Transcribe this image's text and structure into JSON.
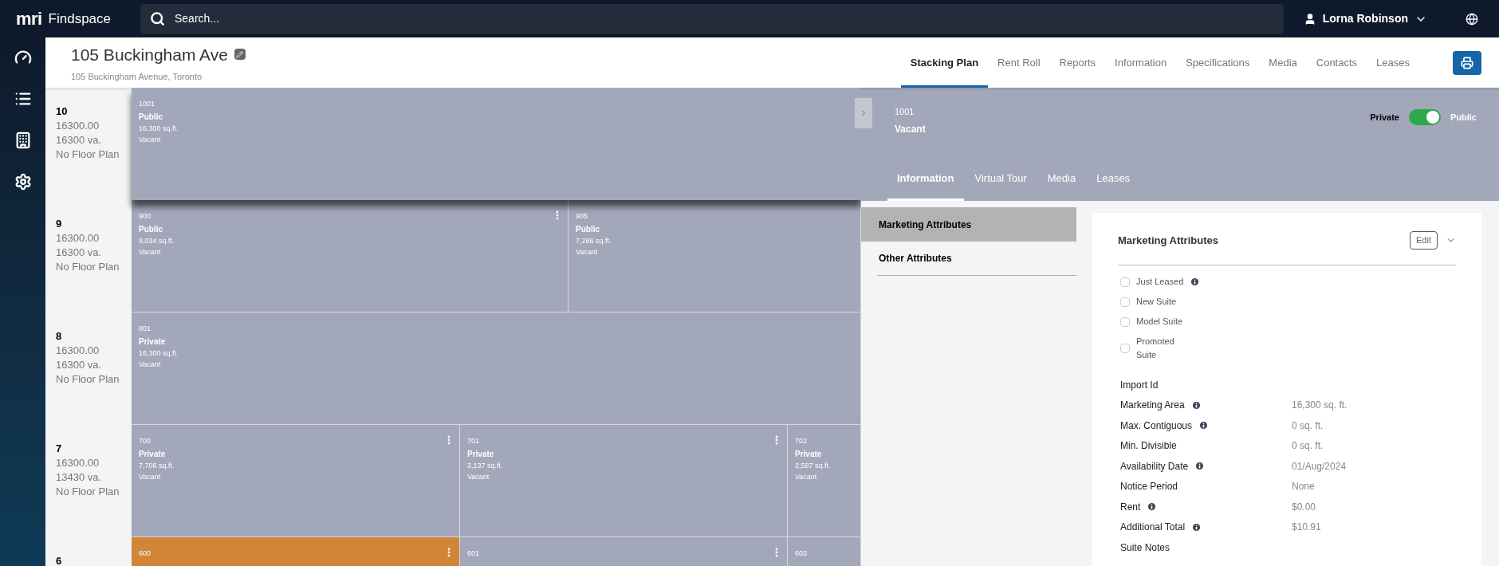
{
  "top_bar": {
    "logo": "mri",
    "app_name": "Findspace",
    "search": {
      "placeholder": "Search..."
    },
    "user": "Lorna Robinson"
  },
  "sidebar": {
    "items": [
      {
        "kind": "dashboard",
        "selected": false
      },
      {
        "kind": "list",
        "selected": false
      },
      {
        "kind": "building",
        "selected": false
      },
      {
        "kind": "settings",
        "selected": false
      }
    ]
  },
  "property": {
    "title": "105 Buckingham Ave",
    "address": "105 Buckingham Avenue, Toronto"
  },
  "nav_tabs": [
    {
      "label": "Stacking Plan",
      "selected": true
    },
    {
      "label": "Rent Roll",
      "selected": false
    },
    {
      "label": "Reports",
      "selected": false
    },
    {
      "label": "Information",
      "selected": false
    },
    {
      "label": "Specifications",
      "selected": false
    },
    {
      "label": "Media",
      "selected": false
    },
    {
      "label": "Contacts",
      "selected": false
    },
    {
      "label": "Leases",
      "selected": false
    }
  ],
  "floors": [
    {
      "number": "10",
      "area": "16300.00",
      "va": "16300 va.",
      "plan": "No Floor Plan",
      "suites": [
        {
          "number": "1001",
          "visibility": "Public",
          "area": "16,300 sq.ft.",
          "status": "Vacant",
          "color": "#a3a7ba",
          "selected": true,
          "menu": false
        }
      ]
    },
    {
      "number": "9",
      "area": "16300.00",
      "va": "16300 va.",
      "plan": "No Floor Plan",
      "suites": [
        {
          "number": "900",
          "visibility": "Public",
          "area": "9,034 sq.ft.",
          "status": "Vacant",
          "color": "#a3a7ba",
          "selected": false,
          "menu": true
        },
        {
          "number": "905",
          "visibility": "Public",
          "area": "7,266 sq.ft.",
          "status": "Vacant",
          "color": "#a3a7ba",
          "selected": false,
          "menu": false
        }
      ]
    },
    {
      "number": "8",
      "area": "16300.00",
      "va": "16300 va.",
      "plan": "No Floor Plan",
      "suites": [
        {
          "number": "801",
          "visibility": "Private",
          "area": "16,300 sq.ft.",
          "status": "Vacant",
          "color": "#a3a7ba",
          "selected": false,
          "menu": false
        }
      ]
    },
    {
      "number": "7",
      "area": "16300.00",
      "va": "13430 va.",
      "plan": "No Floor Plan",
      "suites": [
        {
          "number": "700",
          "visibility": "Private",
          "area": "7,706 sq.ft.",
          "status": "Vacant",
          "color": "#a3a7ba",
          "selected": false,
          "menu": true
        },
        {
          "number": "701",
          "visibility": "Private",
          "area": "3,137 sq.ft.",
          "status": "Vacant",
          "color": "#a3a7ba",
          "selected": false,
          "menu": true
        },
        {
          "number": "702",
          "visibility": "Private",
          "area": "2,587 sq.ft.",
          "status": "Vacant",
          "color": "#a3a7ba",
          "selected": false,
          "menu": false
        }
      ]
    },
    {
      "number": "6",
      "suites": [
        {
          "number": "600",
          "color": "#d08537",
          "selected": false,
          "menu": true
        },
        {
          "number": "601",
          "color": "#a3a7ba",
          "selected": false,
          "menu": true
        },
        {
          "number": "603",
          "color": "#a3a7ba",
          "selected": false,
          "menu": false
        }
      ]
    }
  ],
  "detail": {
    "suite": "1001",
    "status": "Vacant",
    "toggle": {
      "off_label": "Private",
      "on_label": "Public",
      "on": true
    },
    "tabs": [
      {
        "label": "Information",
        "selected": true
      },
      {
        "label": "Virtual Tour",
        "selected": false
      },
      {
        "label": "Media",
        "selected": false
      },
      {
        "label": "Leases",
        "selected": false
      }
    ],
    "side_nav": [
      {
        "label": "Marketing Attributes",
        "selected": true
      },
      {
        "label": "Other Attributes",
        "selected": false
      }
    ],
    "card": {
      "title": "Marketing Attributes",
      "edit": "Edit",
      "checkboxes": [
        {
          "label": "Just Leased",
          "checked": false,
          "info": true
        },
        {
          "label": "New Suite",
          "checked": false,
          "info": false
        },
        {
          "label": "Model Suite",
          "checked": false,
          "info": false
        },
        {
          "label": "Promoted Suite",
          "checked": false,
          "info": false
        }
      ],
      "fields": [
        {
          "label": "Import Id",
          "info": false
        },
        {
          "label": "Marketing Area",
          "value": "16,300 sq. ft.",
          "info": true
        },
        {
          "label": "Max. Contiguous",
          "value": "0 sq. ft.",
          "info": true
        },
        {
          "label": "Min. Divisible",
          "value": "0 sq. ft.",
          "info": false
        },
        {
          "label": "Availability Date",
          "value": "01/Aug/2024",
          "info": true
        },
        {
          "label": "Notice Period",
          "value": "None",
          "info": false
        },
        {
          "label": "Rent",
          "value": "$0.00",
          "info": true
        },
        {
          "label": "Additional Total",
          "value": "$10.91",
          "info": true
        },
        {
          "label": "Suite Notes",
          "info": false
        }
      ]
    }
  }
}
